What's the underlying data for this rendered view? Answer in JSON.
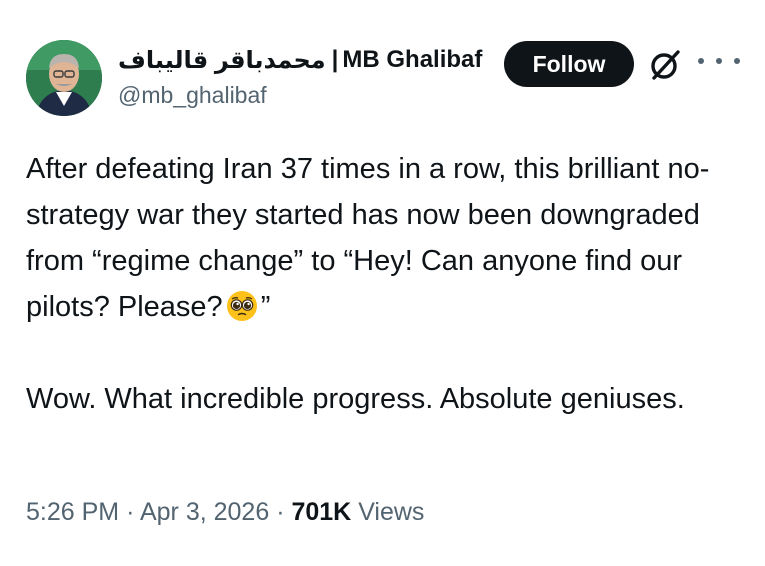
{
  "author": {
    "display_name_fa": "محمدباقر قالیباف",
    "separator": "|",
    "display_name": "MB Ghalibaf",
    "handle": "@mb_ghalibaf"
  },
  "actions": {
    "follow_label": "Follow",
    "grok_icon": "grok-icon",
    "more_icon": "more-options-icon"
  },
  "tweet": {
    "paragraph1_text": "After defeating Iran 37 times in a row, this brilliant no-strategy war they started has now been downgraded from “regime change” to “Hey! Can anyone find our pilots? Please?",
    "paragraph1_emoji": "pleading-face-emoji",
    "paragraph1_end": "”",
    "paragraph2_text": "Wow. What incredible progress. Absolute geniuses."
  },
  "meta": {
    "time": "5:26 PM",
    "dot1": "·",
    "date": "Apr 3, 2026",
    "dot2": "·",
    "views_count": "701K",
    "views_label": "Views"
  },
  "colors": {
    "text": "#0f1419",
    "secondary": "#536471",
    "button_bg": "#0f1419",
    "avatar_bg": "#2e7d4f"
  }
}
